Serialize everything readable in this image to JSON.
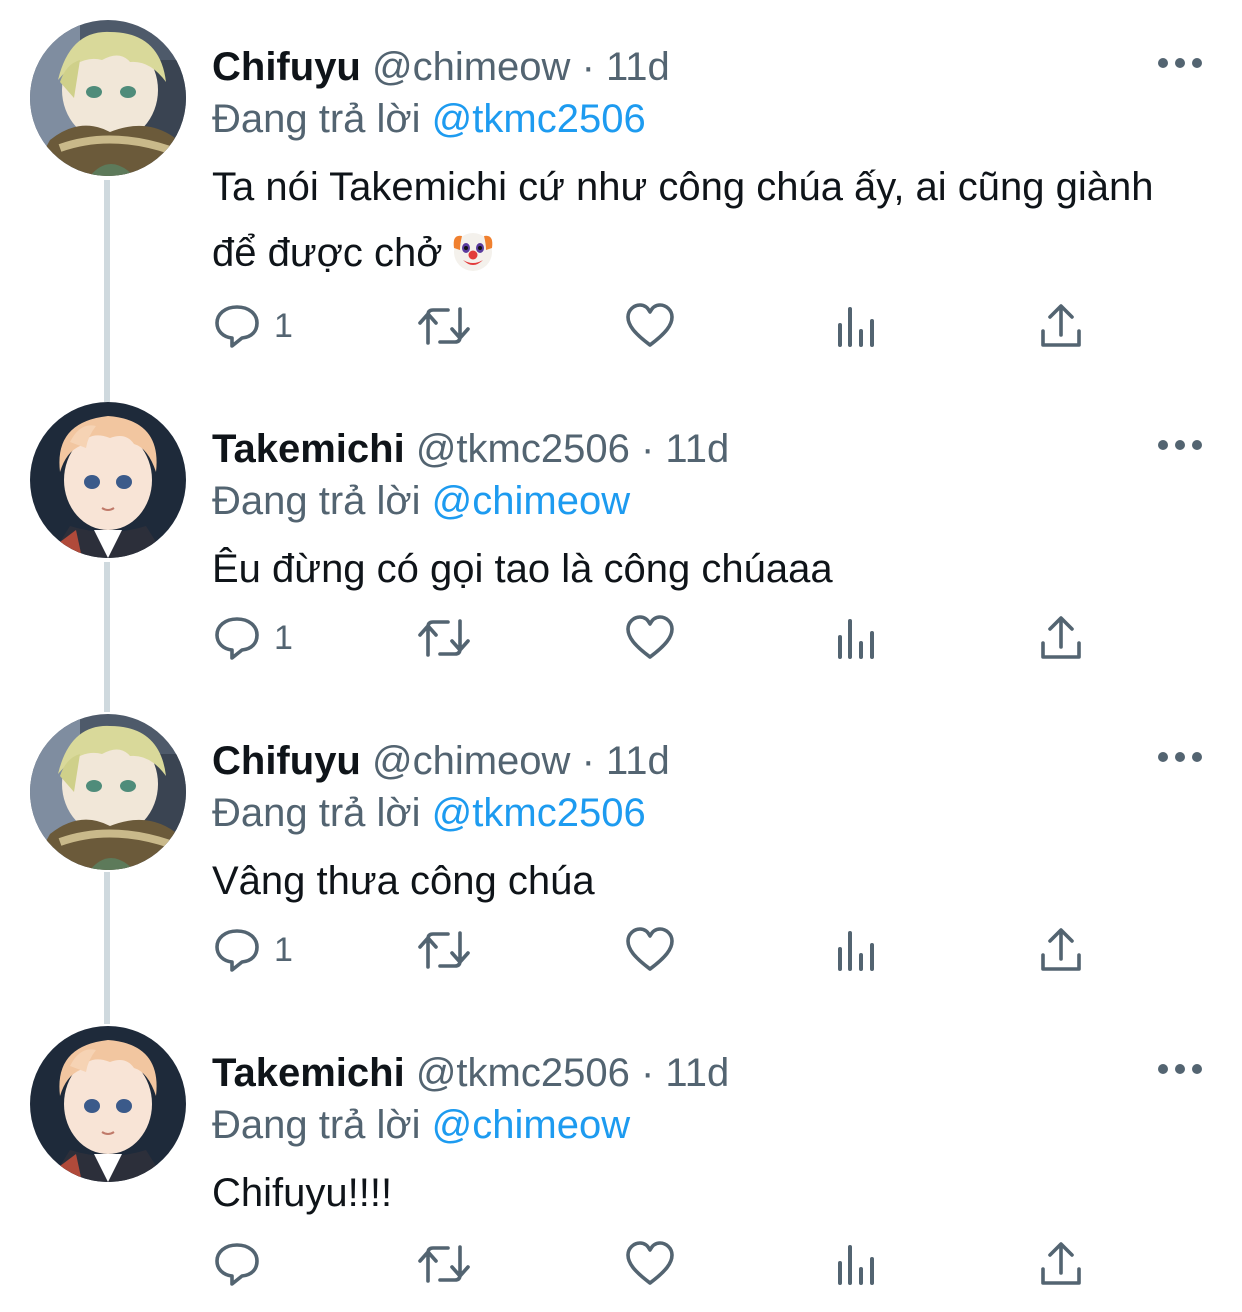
{
  "colors": {
    "accent": "#1d9bf0",
    "secondary_text": "#536471",
    "primary_text": "#0f1419",
    "thread_line": "#cfd9de"
  },
  "tweets": [
    {
      "name": "Chifuyu",
      "handle": "@chimeow",
      "separator": "·",
      "time": "11d",
      "reply_prefix": "Đang trả lời",
      "reply_to": "@tkmc2506",
      "text": "Ta nói Takemichi cứ như công chúa ấy, ai cũng giành để được chở",
      "emoji": "clown-face-emoji",
      "reply_count": "1",
      "avatar": "chifuyu-avatar"
    },
    {
      "name": "Takemichi",
      "handle": "@tkmc2506",
      "separator": "·",
      "time": "11d",
      "reply_prefix": "Đang trả lời",
      "reply_to": "@chimeow",
      "text": "Êu đừng có gọi tao là công chúaaa",
      "reply_count": "1",
      "avatar": "takemichi-avatar"
    },
    {
      "name": "Chifuyu",
      "handle": "@chimeow",
      "separator": "·",
      "time": "11d",
      "reply_prefix": "Đang trả lời",
      "reply_to": "@tkmc2506",
      "text": "Vâng thưa công chúa",
      "reply_count": "1",
      "avatar": "chifuyu-avatar"
    },
    {
      "name": "Takemichi",
      "handle": "@tkmc2506",
      "separator": "·",
      "time": "11d",
      "reply_prefix": "Đang trả lời",
      "reply_to": "@chimeow",
      "text": "Chifuyu!!!!",
      "reply_count": "",
      "avatar": "takemichi-avatar"
    }
  ],
  "icons": {
    "reply": "reply-icon",
    "retweet": "retweet-icon",
    "like": "like-icon",
    "analytics": "analytics-icon",
    "share": "share-icon",
    "more": "more-icon"
  }
}
